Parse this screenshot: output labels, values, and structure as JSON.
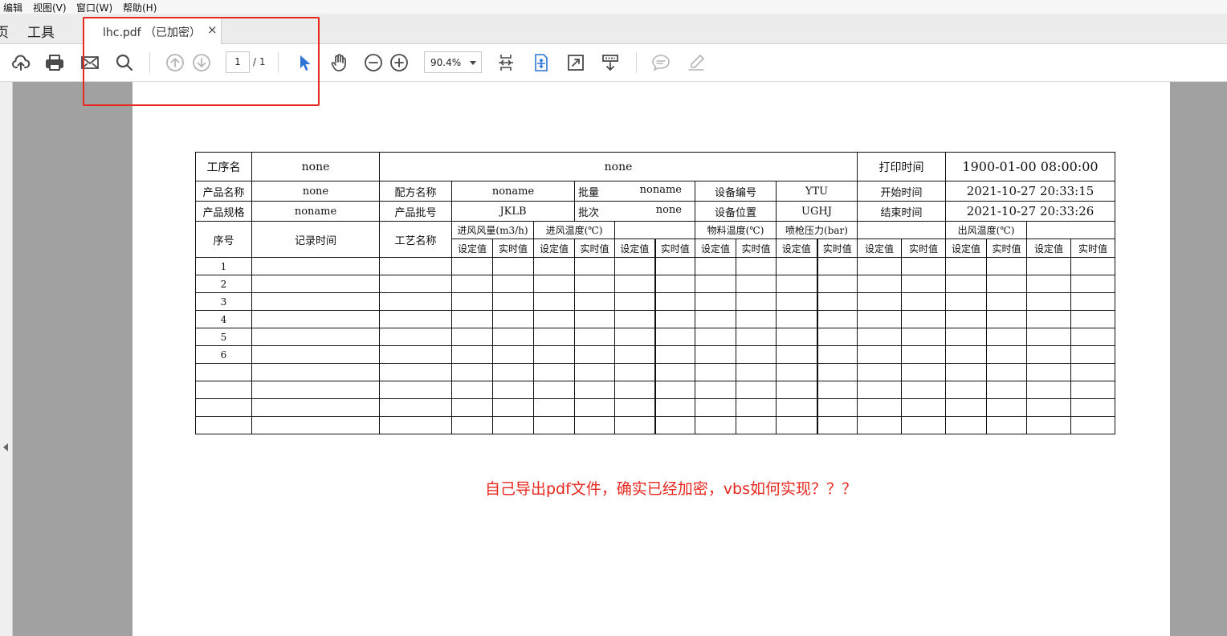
{
  "menubar": {
    "items": [
      {
        "label": "编辑"
      },
      {
        "label": "视图(V)"
      },
      {
        "label": "窗口(W)"
      },
      {
        "label": "帮助(H)"
      }
    ]
  },
  "tabbar": {
    "home_label": "页",
    "tools_label": "工具",
    "doc_tab": {
      "title": "lhc.pdf （已加密）",
      "close_glyph": "×"
    }
  },
  "toolbar": {
    "icons": [
      "upload-cloud-icon",
      "print-icon",
      "mail-icon",
      "search-icon",
      "prev-page-icon",
      "next-page-icon",
      "select-cursor-icon",
      "hand-icon",
      "zoom-out-icon",
      "zoom-in-icon",
      "fit-page-icon",
      "fit-width-icon",
      "full-screen-icon",
      "scroll-mode-icon",
      "comment-icon",
      "sign-icon"
    ],
    "page_current": "1",
    "page_total": "/ 1",
    "zoom": "90.4%",
    "accent": "#2d74d6",
    "icon_color": "#4a4a4a",
    "disabled_color": "#b5b5b5"
  },
  "highlight_box_color": "#e8271f",
  "document": {
    "row1": {
      "c1": "工序名",
      "c2": "none",
      "c3": "none",
      "c4": "打印时间",
      "c5": "1900-01-00 08:00:00"
    },
    "row2": {
      "c1": "产品名称",
      "c2": "none",
      "c3": "配方名称",
      "c4": "noname",
      "c5l": "批量",
      "c5r": "noname",
      "c6": "设备编号",
      "c7": "YTU",
      "c8": "开始时间",
      "c9": "2021-10-27 20:33:15"
    },
    "row3": {
      "c1": "产品规格",
      "c2": "noname",
      "c3": "产品批号",
      "c4": "JKLB",
      "c5l": "批次",
      "c5r": "none",
      "c6": "设备位置",
      "c7": "UGHJ",
      "c8": "结束时间",
      "c9": "2021-10-27 20:33:26"
    },
    "header": {
      "seq": "序号",
      "record_time": "记录时间",
      "process_name": "工艺名称",
      "groups": [
        "进风风量(m3/h)",
        "进风温度(℃)",
        "",
        "物料温度(℃)",
        "喷枪压力(bar)",
        "",
        "出风温度(℃)",
        ""
      ],
      "sub": [
        "设定值",
        "实时值"
      ]
    },
    "row_numbers": [
      "1",
      "2",
      "3",
      "4",
      "5",
      "6",
      "",
      "",
      "",
      ""
    ],
    "note": "自己导出pdf文件，确实已经加密，vbs如何实现？？？"
  }
}
